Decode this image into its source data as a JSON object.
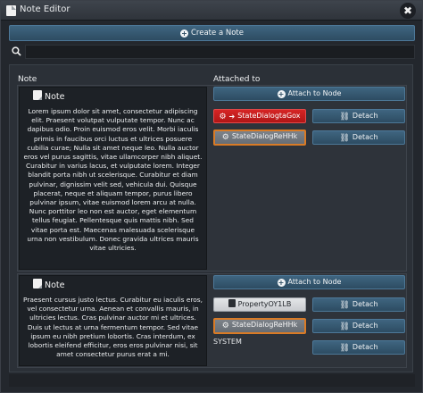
{
  "window": {
    "title": "Note Editor",
    "close_glyph": "✖"
  },
  "toolbar": {
    "create_label": "Create a Note"
  },
  "search": {
    "value": "",
    "placeholder": ""
  },
  "columns": {
    "note": "Note",
    "attached": "Attached to"
  },
  "rows": [
    {
      "note_title": "Note",
      "note_text": "Lorem ipsum dolor sit amet, consectetur adipiscing elit. Praesent volutpat vulputate tempor. Nunc ac dapibus odio. Proin euismod eros velit. Morbi iaculis primis in faucibus orci luctus et ultrices posuere cubilia curae; Nulla sit amet neque leo. Nulla auctor eros vel purus sagittis, vitae ullamcorper nibh aliquet. Curabitur in varius lacus, et vulputate lorem. Integer blandit porta nibh ut scelerisque. Curabitur et diam pulvinar, dignissim velit sed, vehicula dui. Quisque placerat, neque et aliquam tempor, purus libero pulvinar ipsum, vitae euismod lorem arcu at nulla. Nunc porttitor leo non est auctor, eget elementum tellus feugiat. Pellentesque quis mattis nibh. Sed vitae porta est. Maecenas malesuada scelerisque urna non vestibulum. Donec gravida ultrices mauris vitae ultricies.",
      "attach_label": "Attach to Node",
      "attachments": [
        {
          "label": "StateDialogtaGox",
          "style": "red",
          "icon": "gear-arrow-icon"
        },
        {
          "label": "StateDialogReHHk",
          "style": "gray-selected",
          "icon": "gear-icon"
        }
      ],
      "detach_labels": [
        "Detach",
        "Detach"
      ]
    },
    {
      "note_title": "Note",
      "note_text": "Praesent cursus justo lectus. Curabitur eu iaculis eros, vel consectetur urna. Aenean et convallis mauris, in ultricies lectus. Cras pulvinar auctor mi et ultrices. Duis ut lectus at urna fermentum tempor. Sed vitae ipsum eu nibh pretium lobortis. Cras interdum, ex lobortis eleifend efficitur, eros eros pulvinar nisi, sit amet consectetur purus erat a mi.",
      "attach_label": "Attach to Node",
      "attachments": [
        {
          "label": "PropertyOY1LB",
          "style": "light",
          "icon": "book-icon"
        },
        {
          "label": "StateDialogReHHk",
          "style": "gray-selected",
          "icon": "gear-icon"
        },
        {
          "label": "SYSTEM",
          "style": "text",
          "icon": ""
        }
      ],
      "detach_labels": [
        "Detach",
        "Detach",
        "Detach"
      ]
    }
  ],
  "colors": {
    "accent_blue": "#3f6580",
    "danger_red": "#d62525",
    "selected_orange": "#d97b26",
    "background": "#23272d"
  }
}
